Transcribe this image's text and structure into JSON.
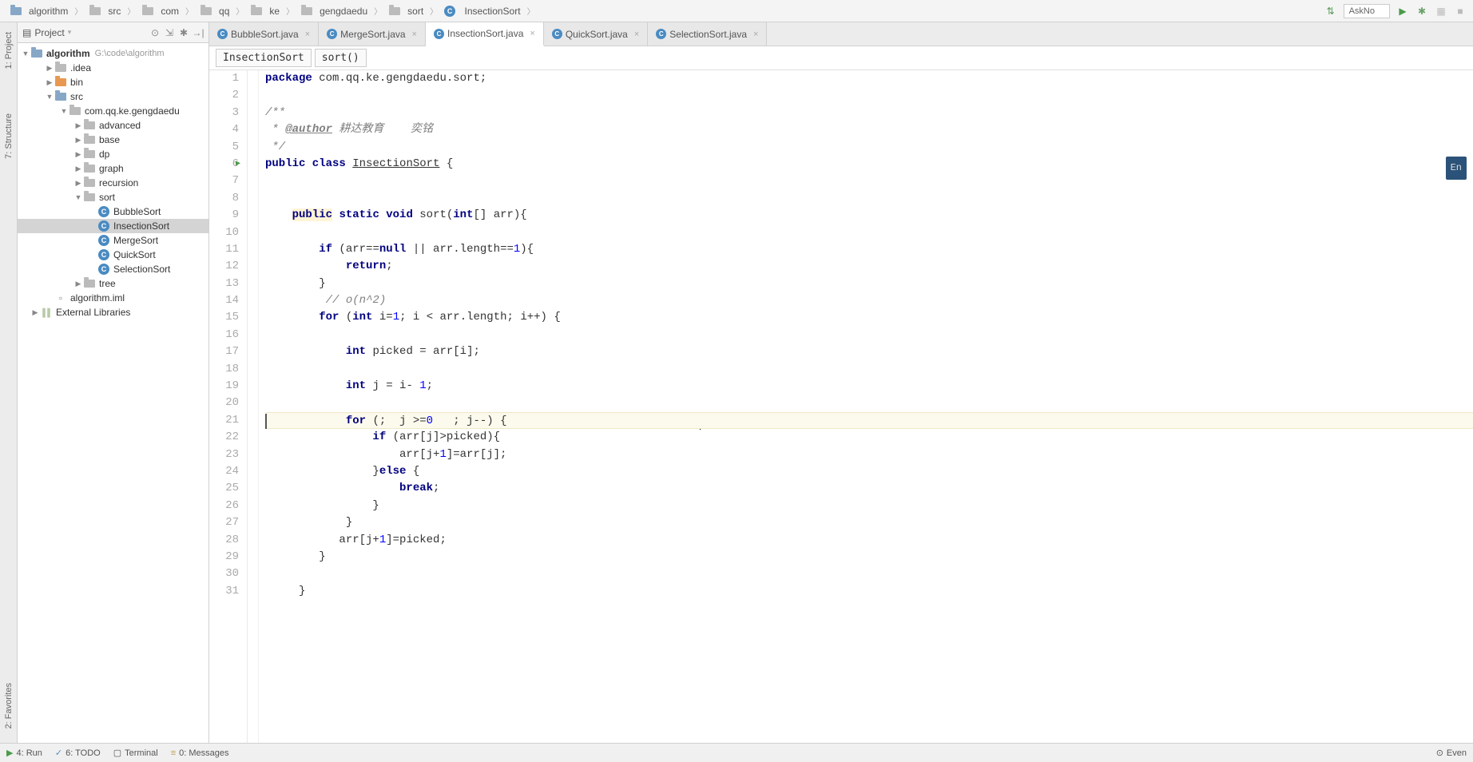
{
  "breadcrumb": [
    "algorithm",
    "src",
    "com",
    "qq",
    "ke",
    "gengdaedu",
    "sort",
    "InsectionSort"
  ],
  "toolbar": {
    "askno": "AskNo"
  },
  "panel": {
    "title": "Project",
    "root": {
      "name": "algorithm",
      "hint": "G:\\code\\algorithm"
    },
    "items": [
      {
        "label": ".idea",
        "depth": 1,
        "type": "folder-gray",
        "expand": "▶"
      },
      {
        "label": "bin",
        "depth": 1,
        "type": "folder-orange",
        "expand": "▶"
      },
      {
        "label": "src",
        "depth": 1,
        "type": "folder-blue",
        "expand": "▼"
      },
      {
        "label": "com.qq.ke.gengdaedu",
        "depth": 2,
        "type": "folder-gray",
        "expand": "▼"
      },
      {
        "label": "advanced",
        "depth": 3,
        "type": "folder-gray",
        "expand": "▶"
      },
      {
        "label": "base",
        "depth": 3,
        "type": "folder-gray",
        "expand": "▶"
      },
      {
        "label": "dp",
        "depth": 3,
        "type": "folder-gray",
        "expand": "▶"
      },
      {
        "label": "graph",
        "depth": 3,
        "type": "folder-gray",
        "expand": "▶"
      },
      {
        "label": "recursion",
        "depth": 3,
        "type": "folder-gray",
        "expand": "▶"
      },
      {
        "label": "sort",
        "depth": 3,
        "type": "folder-gray",
        "expand": "▼"
      },
      {
        "label": "BubbleSort",
        "depth": 4,
        "type": "class",
        "expand": ""
      },
      {
        "label": "InsectionSort",
        "depth": 4,
        "type": "class",
        "expand": "",
        "selected": true
      },
      {
        "label": "MergeSort",
        "depth": 4,
        "type": "class",
        "expand": ""
      },
      {
        "label": "QuickSort",
        "depth": 4,
        "type": "class",
        "expand": ""
      },
      {
        "label": "SelectionSort",
        "depth": 4,
        "type": "class",
        "expand": ""
      },
      {
        "label": "tree",
        "depth": 3,
        "type": "folder-gray",
        "expand": "▶"
      },
      {
        "label": "algorithm.iml",
        "depth": 1,
        "type": "file",
        "expand": ""
      },
      {
        "label": "External Libraries",
        "depth": 0,
        "type": "lib",
        "expand": "▶"
      }
    ]
  },
  "tabs": [
    {
      "label": "BubbleSort.java"
    },
    {
      "label": "MergeSort.java"
    },
    {
      "label": "InsectionSort.java",
      "active": true
    },
    {
      "label": "QuickSort.java"
    },
    {
      "label": "SelectionSort.java"
    }
  ],
  "context": {
    "class": "InsectionSort",
    "method": "sort()"
  },
  "code": {
    "lines": [
      {
        "n": 1,
        "html": "<span class='kw'>package</span> com.qq.ke.gengdaedu.sort;"
      },
      {
        "n": 2,
        "html": ""
      },
      {
        "n": 3,
        "html": "<span class='cm'>/**</span>"
      },
      {
        "n": 4,
        "html": "<span class='cm'> * </span><span class='cm-tag'>@author</span><span class='cm'> 耕达教育    奕铭</span>"
      },
      {
        "n": 5,
        "html": "<span class='cm'> */</span>"
      },
      {
        "n": 6,
        "html": "<span class='kw'>public class</span> <span class='underline'>InsectionSort</span> {",
        "run": true
      },
      {
        "n": 7,
        "html": ""
      },
      {
        "n": 8,
        "html": ""
      },
      {
        "n": 9,
        "html": "    <span class='hl-method'><span class='kw'>public</span></span> <span class='kw'>static void</span> sort(<span class='kw'>int</span>[] arr){"
      },
      {
        "n": 10,
        "html": ""
      },
      {
        "n": 11,
        "html": "        <span class='kw'>if</span> (arr==<span class='kw'>null</span> || arr.length==<span class='num'>1</span>){"
      },
      {
        "n": 12,
        "html": "            <span class='kw'>return</span>;"
      },
      {
        "n": 13,
        "html": "        }"
      },
      {
        "n": 14,
        "html": "         <span class='cm'>// o(n^2)</span>"
      },
      {
        "n": 15,
        "html": "        <span class='kw'>for</span> (<span class='kw'>int</span> i=<span class='num'>1</span>; i &lt; arr.length; i++) {"
      },
      {
        "n": 16,
        "html": ""
      },
      {
        "n": 17,
        "html": "            <span class='kw'>int</span> picked = arr[i];"
      },
      {
        "n": 18,
        "html": ""
      },
      {
        "n": 19,
        "html": "            <span class='kw'>int</span> j = i- <span class='num'>1</span>;"
      },
      {
        "n": 20,
        "html": ""
      },
      {
        "n": 21,
        "html": "            <span class='kw'>for</span> (;  j &gt;=<span class='num'>0</span>   ; j--) {",
        "current": true
      },
      {
        "n": 22,
        "html": "                <span class='kw'>if</span> (arr[j]&gt;picked){"
      },
      {
        "n": 23,
        "html": "                    arr[j+<span class='num'>1</span>]=arr[j];"
      },
      {
        "n": 24,
        "html": "                }<span class='kw'>else</span> {"
      },
      {
        "n": 25,
        "html": "                    <span class='kw'>break</span>;"
      },
      {
        "n": 26,
        "html": "                }"
      },
      {
        "n": 27,
        "html": "            }"
      },
      {
        "n": 28,
        "html": "           arr[j+<span class='num'>1</span>]=picked;"
      },
      {
        "n": 29,
        "html": "        }"
      },
      {
        "n": 30,
        "html": ""
      },
      {
        "n": 31,
        "html": "     }"
      }
    ]
  },
  "vtabs": {
    "project": "1: Project",
    "structure": "7: Structure",
    "favorites": "2: Favorites"
  },
  "bottom": {
    "run": "4: Run",
    "todo": "6: TODO",
    "terminal": "Terminal",
    "messages": "0: Messages",
    "event": "Even"
  },
  "lang": "En"
}
